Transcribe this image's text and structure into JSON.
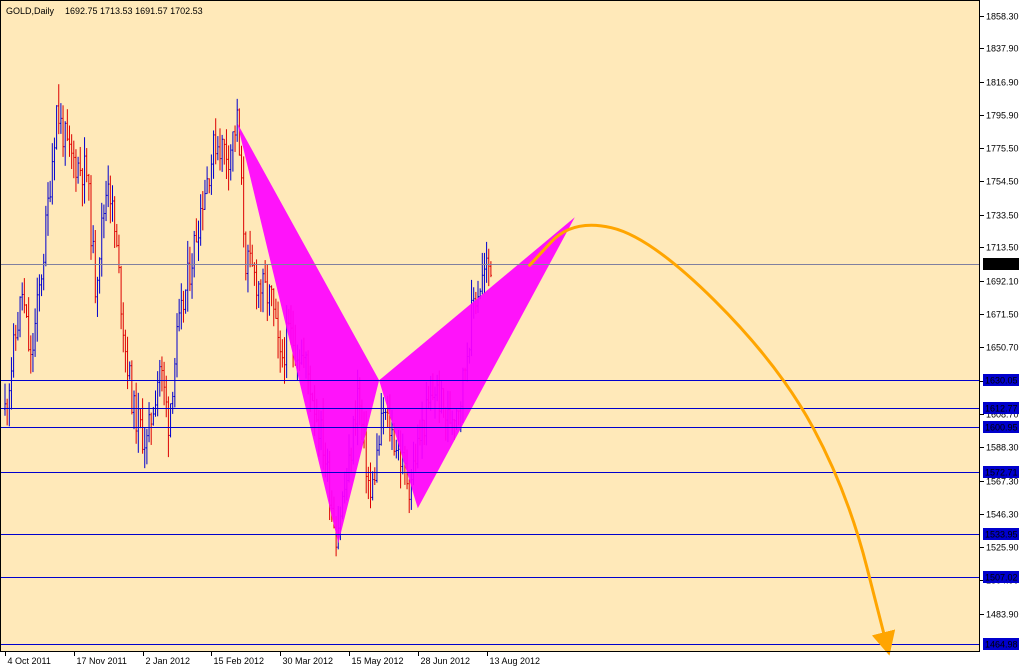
{
  "header": {
    "symbol": "GOLD,Daily",
    "ohlc": "1692.75 1713.53 1691.57 1702.53"
  },
  "colors": {
    "background": "#FFE9B9",
    "border": "#000000",
    "up_bar": "#0000CD",
    "down_bar": "#DD0000",
    "pattern_fill": "#FF00FF",
    "projection": "#FFA500",
    "level_line": "#0000CD",
    "price_tag_bg": "#0000CD",
    "current_tag_bg": "#000000",
    "tag_text": "#FFFFFF"
  },
  "chart_data": {
    "type": "candlestick-ohlc",
    "instrument": "GOLD",
    "timeframe": "Daily",
    "ylim": [
      1460.0,
      1868.0
    ],
    "y_ticks": [
      "1858.30",
      "1837.90",
      "1816.90",
      "1795.90",
      "1775.50",
      "1754.50",
      "1733.50",
      "1713.50",
      "1692.10",
      "1671.50",
      "1650.70",
      "1629.70",
      "1608.70",
      "1588.30",
      "1567.30",
      "1546.30",
      "1525.90",
      "1504.90",
      "1483.90"
    ],
    "y_tick_values": [
      1858.3,
      1837.9,
      1816.9,
      1795.9,
      1775.5,
      1754.5,
      1733.5,
      1713.5,
      1692.1,
      1671.5,
      1650.7,
      1629.7,
      1608.7,
      1588.3,
      1567.3,
      1546.3,
      1525.9,
      1504.9,
      1483.9
    ],
    "x_labels": [
      "4 Oct 2011",
      "17 Nov 2011",
      "2 Jan 2012",
      "15 Feb 2012",
      "30 Mar 2012",
      "15 May 2012",
      "28 Jun 2012",
      "13 Aug 2012"
    ],
    "x_label_bars": [
      0,
      32,
      64,
      96,
      128,
      160,
      192,
      224
    ],
    "price_path": [
      [
        0,
        1612
      ],
      [
        8,
        1685
      ],
      [
        12,
        1640
      ],
      [
        18,
        1710
      ],
      [
        24,
        1800
      ],
      [
        30,
        1770
      ],
      [
        38,
        1760
      ],
      [
        42,
        1690
      ],
      [
        48,
        1760
      ],
      [
        52,
        1710
      ],
      [
        56,
        1650
      ],
      [
        60,
        1610
      ],
      [
        66,
        1590
      ],
      [
        72,
        1640
      ],
      [
        76,
        1605
      ],
      [
        80,
        1655
      ],
      [
        86,
        1700
      ],
      [
        92,
        1745
      ],
      [
        98,
        1780
      ],
      [
        104,
        1772
      ],
      [
        108,
        1792
      ],
      [
        112,
        1705
      ],
      [
        118,
        1690
      ],
      [
        124,
        1680
      ],
      [
        128,
        1640
      ],
      [
        132,
        1660
      ],
      [
        140,
        1640
      ],
      [
        148,
        1590
      ],
      [
        154,
        1535
      ],
      [
        160,
        1575
      ],
      [
        164,
        1623
      ],
      [
        170,
        1555
      ],
      [
        176,
        1610
      ],
      [
        182,
        1590
      ],
      [
        188,
        1565
      ],
      [
        194,
        1600
      ],
      [
        200,
        1625
      ],
      [
        206,
        1605
      ],
      [
        212,
        1620
      ],
      [
        218,
        1680
      ],
      [
        224,
        1700
      ],
      [
        226,
        1702.53
      ]
    ],
    "last_bar_index": 226,
    "current_price": "1702.53",
    "current_price_value": 1702.53,
    "levels": [
      {
        "label": "1630.05",
        "value": 1630.05
      },
      {
        "label": "1612.77",
        "value": 1612.77
      },
      {
        "label": "1600.95",
        "value": 1600.95
      },
      {
        "label": "1572.71",
        "value": 1572.71
      },
      {
        "label": "1533.95",
        "value": 1533.95
      },
      {
        "label": "1507.02",
        "value": 1507.02
      },
      {
        "label": "1464.98",
        "value": 1464.98
      }
    ],
    "harmonic_pattern": {
      "points": [
        {
          "bar": 108,
          "price": 1791
        },
        {
          "bar": 155,
          "price": 1528
        },
        {
          "bar": 174,
          "price": 1630
        },
        {
          "bar": 192,
          "price": 1550
        },
        {
          "bar": 265,
          "price": 1732
        }
      ]
    },
    "projection": {
      "path": [
        {
          "bar": 244,
          "price": 1702
        },
        {
          "bar": 264,
          "price": 1731
        },
        {
          "bar": 300,
          "price": 1720
        },
        {
          "bar": 360,
          "price": 1640
        },
        {
          "bar": 392,
          "price": 1560
        },
        {
          "bar": 410,
          "price": 1465
        }
      ]
    }
  }
}
